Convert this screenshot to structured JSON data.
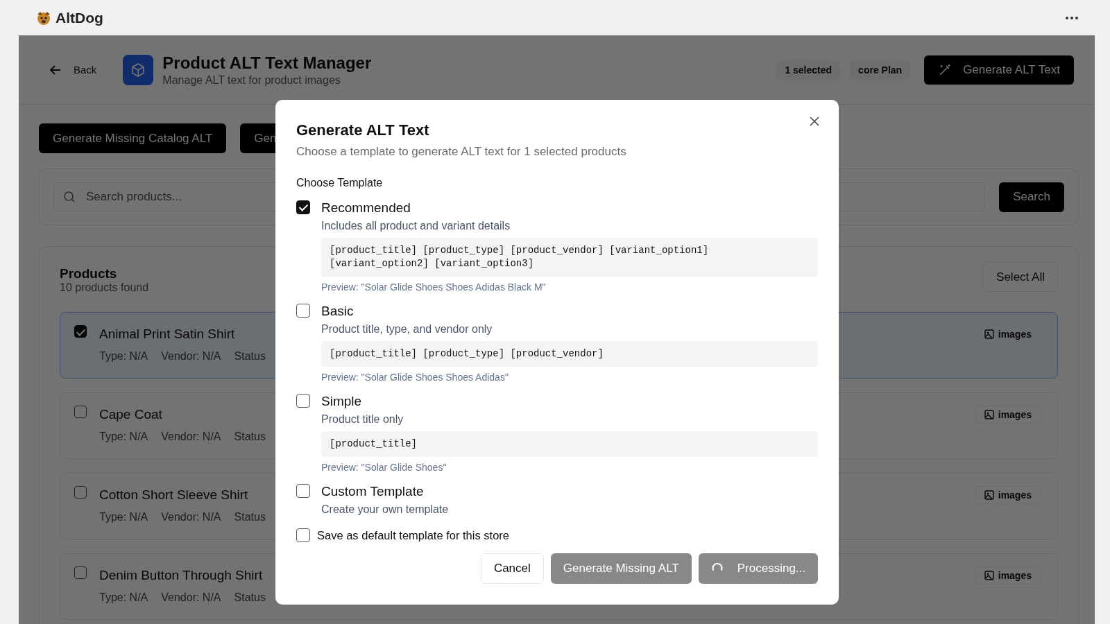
{
  "app": {
    "name": "AltDog"
  },
  "header": {
    "back": "Back",
    "title": "Product ALT Text Manager",
    "subtitle": "Manage ALT text for product images",
    "selected_badge": "1 selected",
    "plan_badge": "core Plan",
    "generate_button": "Generate ALT Text"
  },
  "actions": [
    "Generate Missing Catalog ALT",
    "Gen"
  ],
  "search": {
    "placeholder": "Search products...",
    "button": "Search"
  },
  "products": {
    "title": "Products",
    "count": "10 products found",
    "select_all": "Select All",
    "rows": [
      {
        "name": "Animal Print Satin Shirt",
        "selected": true,
        "meta": [
          "Type: N/A",
          "Vendor: N/A",
          "Status"
        ],
        "images": "images"
      },
      {
        "name": "Cape Coat",
        "selected": false,
        "meta": [
          "Type: N/A",
          "Vendor: N/A",
          "Status"
        ],
        "images": "images"
      },
      {
        "name": "Cotton Short Sleeve Shirt",
        "selected": false,
        "meta": [
          "Type: N/A",
          "Vendor: N/A",
          "Status"
        ],
        "images": "images"
      },
      {
        "name": "Denim Button Through Shirt",
        "selected": false,
        "meta": [
          "Type: N/A",
          "Vendor: N/A",
          "Status"
        ],
        "images": "images"
      }
    ]
  },
  "modal": {
    "title": "Generate ALT Text",
    "subtitle": "Choose a template to generate ALT text for 1 selected products",
    "section_label": "Choose Template",
    "templates": [
      {
        "name": "Recommended",
        "checked": true,
        "description": "Includes all product and variant details",
        "pattern": "[product_title] [product_type] [product_vendor] [variant_option1] [variant_option2] [variant_option3]",
        "preview": "Preview: \"Solar Glide Shoes Shoes Adidas Black M\""
      },
      {
        "name": "Basic",
        "checked": false,
        "description": "Product title, type, and vendor only",
        "pattern": "[product_title] [product_type] [product_vendor]",
        "preview": "Preview: \"Solar Glide Shoes Shoes Adidas\""
      },
      {
        "name": "Simple",
        "checked": false,
        "description": "Product title only",
        "pattern": "[product_title]",
        "preview": "Preview: \"Solar Glide Shoes\""
      },
      {
        "name": "Custom Template",
        "checked": false,
        "description": "Create your own template"
      }
    ],
    "default_option": {
      "label": "Save as default template for this store",
      "checked": false
    },
    "buttons": [
      {
        "label": "Cancel",
        "kind": "outline"
      },
      {
        "label": "Generate Missing ALT",
        "kind": "muted"
      },
      {
        "label": "Processing...",
        "kind": "loading"
      }
    ]
  }
}
